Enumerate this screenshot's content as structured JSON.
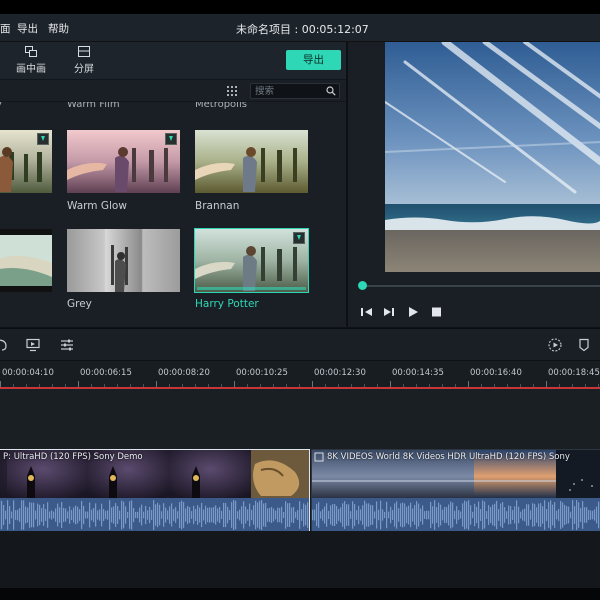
{
  "menu": {
    "item_cut": "面",
    "export": "导出",
    "help": "帮助"
  },
  "window_title": "未命名项目 : 00:05:12:07",
  "toolbar": {
    "pip": "画中画",
    "split_screen": "分屏",
    "export_button": "导出"
  },
  "search": {
    "placeholder": "搜索"
  },
  "filters": {
    "top_captions": [
      "Warm Film",
      "Metropolis"
    ],
    "items": [
      {
        "label": ""
      },
      {
        "label": "Warm Glow"
      },
      {
        "label": "Brannan"
      },
      {
        "label": ""
      },
      {
        "label": "Grey"
      },
      {
        "label": "Harry Potter"
      }
    ]
  },
  "player": {
    "progress": 0.0
  },
  "ruler": {
    "ticks": [
      "00:00:04:10",
      "00:00:06:15",
      "00:00:08:20",
      "00:00:10:25",
      "00:00:12:30",
      "00:00:14:35",
      "00:00:16:40",
      "00:00:18:45"
    ]
  },
  "clips": [
    {
      "title": "P: UltraHD  (120 FPS)  Sony Demo"
    },
    {
      "title": "8K VIDEOS   World 8K Videos HDR UltraHD  (120 FPS)  Sony"
    }
  ],
  "colors": {
    "accent": "#2ed8b6",
    "playhead": "#c9363a",
    "audio": "#3b5a8a"
  }
}
